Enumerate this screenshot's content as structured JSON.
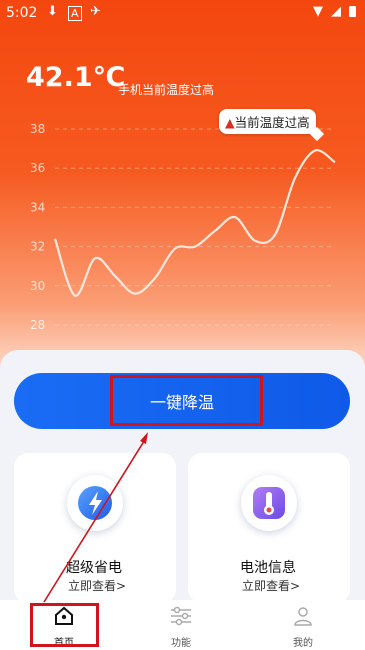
{
  "status_bar": {
    "time": "5:02",
    "icons": [
      "download-icon",
      "font-a-icon",
      "app-icon",
      "wifi-icon",
      "signal-icon",
      "battery-icon"
    ]
  },
  "hero": {
    "temperature": "42.1℃",
    "label": "手机当前温度过高",
    "warning": "当前温度过高"
  },
  "chart_data": {
    "type": "line",
    "title": "",
    "xlabel": "",
    "ylabel": "",
    "ylim": [
      28,
      38
    ],
    "yticks": [
      "38",
      "36",
      "34",
      "32",
      "30",
      "28"
    ],
    "x": [
      0,
      1,
      2,
      3,
      4,
      5,
      6,
      7,
      8,
      9,
      10,
      11,
      12,
      13,
      14
    ],
    "values": [
      32.4,
      29.5,
      31.4,
      30.5,
      29.6,
      30.4,
      31.9,
      32.0,
      32.8,
      33.5,
      32.3,
      32.6,
      35.5,
      36.9,
      36.3
    ],
    "grid": true,
    "color": "#ffffff"
  },
  "actions": {
    "cool_down": "一键降温"
  },
  "cards": [
    {
      "title": "超级省电",
      "subtitle": "立即查看>",
      "icon": "lightning-icon"
    },
    {
      "title": "电池信息",
      "subtitle": "立即查看>",
      "icon": "thermometer-icon"
    }
  ],
  "tabs": [
    {
      "label": "首页",
      "icon": "home-icon",
      "active": true
    },
    {
      "label": "功能",
      "icon": "sliders-icon",
      "active": false
    },
    {
      "label": "我的",
      "icon": "user-icon",
      "active": false
    }
  ],
  "colors": {
    "accent": "#1a6cf5",
    "hero_top": "#f4470f",
    "annotation": "#d0141c"
  }
}
